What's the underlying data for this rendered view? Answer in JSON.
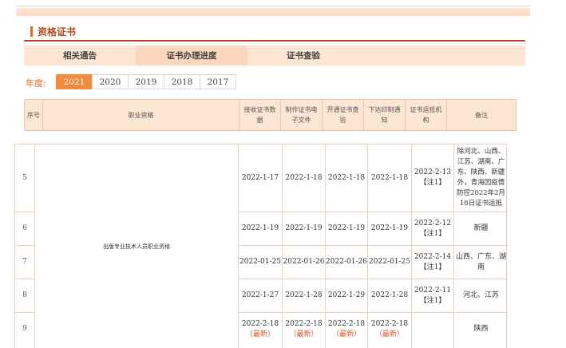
{
  "section": {
    "title": "资格证书"
  },
  "tabs": [
    {
      "label": "相关通告",
      "active": false
    },
    {
      "label": "证书办理进度",
      "active": true
    },
    {
      "label": "证书查验",
      "active": false
    }
  ],
  "years": {
    "label": "年度:",
    "items": [
      "2021",
      "2020",
      "2019",
      "2018",
      "2017"
    ],
    "selected": "2021"
  },
  "table": {
    "headers": [
      "序号",
      "职业资格",
      "接收证书数据",
      "制作证书电子文件",
      "开通证书查验",
      "下达印制通知",
      "证书运抵机构",
      "备注"
    ],
    "qualification": "出版专业技术人员职业资格",
    "rows": [
      {
        "no": "5",
        "receive": "2022-1-17",
        "make": "2022-1-18",
        "verify": "2022-1-18",
        "print": "2022-1-18",
        "arrive": "2022-2-13",
        "arrive_note": "【注1】",
        "remark": "除河北、山西、江苏、湖南、广东、陕西、新疆外，青海因疫情防控2022年2月18日证书运抵"
      },
      {
        "no": "6",
        "receive": "2022-1-19",
        "make": "2022-1-19",
        "verify": "2022-1-19",
        "print": "2022-1-19",
        "arrive": "2022-2-12",
        "arrive_note": "【注1】",
        "remark": "新疆"
      },
      {
        "no": "7",
        "receive": "2022-01-25",
        "make": "2022-01-26",
        "verify": "2022-01-26",
        "print": "2022-01-25",
        "arrive": "2022-2-14",
        "arrive_note": "【注1】",
        "remark": "山西、广东、湖南"
      },
      {
        "no": "8",
        "receive": "2022-1-27",
        "make": "2022-1-28",
        "verify": "2022-1-29",
        "print": "2022-1-28",
        "arrive": "2022-2-11",
        "arrive_note": "【注1】",
        "remark": "河北、江苏"
      },
      {
        "no": "9",
        "receive": "2022-2-18",
        "make": "2022-2-18",
        "verify": "2022-2-18",
        "print": "2022-2-18",
        "arrive": "",
        "arrive_note": "",
        "remark": "陕西",
        "tag": "（最新）"
      }
    ]
  },
  "colors": {
    "accent": "#e06a1f",
    "tab_bg": "#fbe6d4",
    "active_year": "#f08a3c",
    "header_text": "#b84a22",
    "new_tag": "#e0532b"
  }
}
